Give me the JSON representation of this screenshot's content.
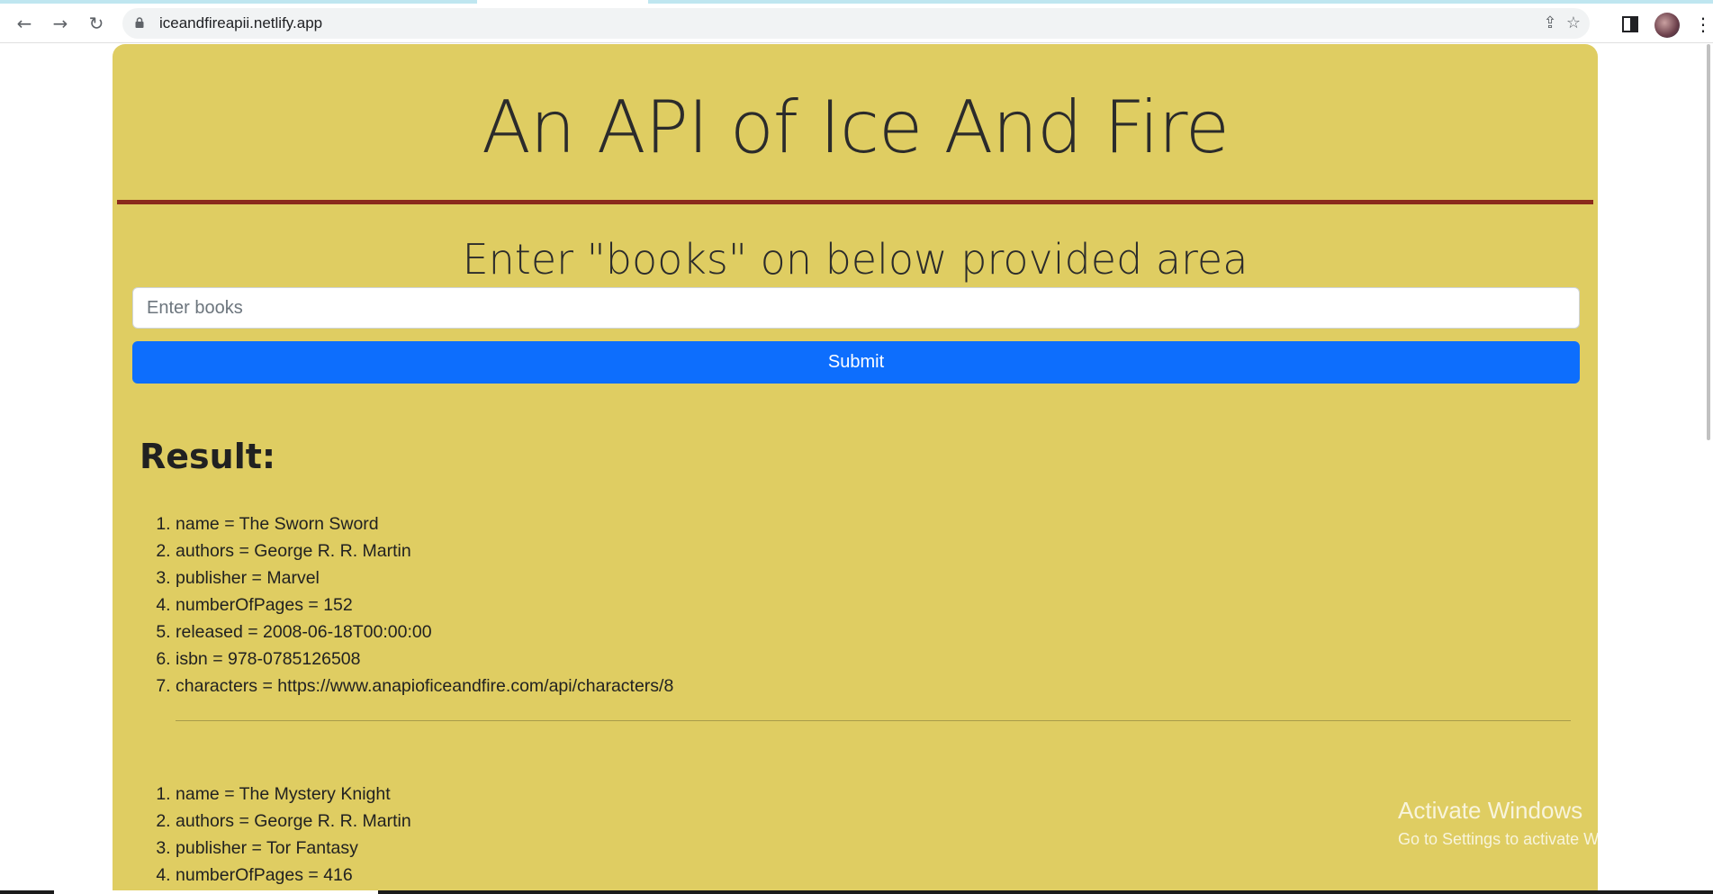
{
  "browser": {
    "url": "iceandfireapii.netlify.app",
    "back_icon": "←",
    "forward_icon": "→",
    "reload_icon": "↻",
    "share_icon": "⇪",
    "star_icon": "☆",
    "menu_icon": "⋮"
  },
  "header": {
    "title": "An API of Ice And Fire",
    "accent_color": "#8b2a1c",
    "background_color": "#dfcd62"
  },
  "form": {
    "prompt": "Enter \"books\" on below provided area",
    "input_placeholder": "Enter books",
    "input_value": "",
    "submit_label": "Submit",
    "submit_color": "#0d6efd"
  },
  "results": {
    "heading": "Result:",
    "books": [
      {
        "items": [
          "name = The Sworn Sword",
          "authors = George R. R. Martin",
          "publisher = Marvel",
          "numberOfPages = 152",
          "released = 2008-06-18T00:00:00",
          "isbn = 978-0785126508",
          "characters = https://www.anapioficeandfire.com/api/characters/8"
        ]
      },
      {
        "items": [
          "name = The Mystery Knight",
          "authors = George R. R. Martin",
          "publisher = Tor Fantasy",
          "numberOfPages = 416"
        ]
      }
    ]
  },
  "watermark": {
    "title": "Activate Windows",
    "subtitle": "Go to Settings to activate Windows."
  }
}
